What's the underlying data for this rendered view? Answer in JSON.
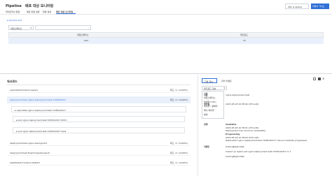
{
  "header": {
    "title": "Pipeline",
    "separator": "›",
    "page": "배포 대상 모니터링",
    "right_buttons": [
      "URL & Apikey",
      "마블어 가이드"
    ],
    "tabs": [
      "파이프라인 편집",
      "배포 환경 설정",
      "환경 설정",
      "배포 대상 모니터링"
    ],
    "active_tab": 3
  },
  "top": {
    "pipeline_link": "pipeline-test",
    "select_value": "네임스페이스",
    "search_placeholder": "",
    "table_headers": [
      "네임스페이스",
      "워크로드"
    ],
    "table_row": [
      "test",
      "15"
    ]
  },
  "bottom_left": {
    "title": "워크로드",
    "rows": [
      {
        "name": "replicaSet-frontend-replica",
        "state": "화드: 4 / 1(100%)"
      },
      {
        "name": "deployment-test-nginx-deployment-test-74d5b4dd17",
        "state": "화드: 4 / 1(100%)",
        "selected": true
      },
      {
        "name": "replicaSet-nginx-deployment-test-74d5b4dd17",
        "sub": true
      },
      {
        "name": "pod-nginx-deployment-test-74d5b4dd17-8ctrb",
        "sub2": true
      },
      {
        "name": "pod-nginx-deployment-test-74d5b4dd17-fvpq",
        "sub2": true
      },
      {
        "name": "deployment-test-nginx-deployment",
        "state": "화드: 4 / 1(100%)"
      },
      {
        "name": "deployment-test-fluentd-elasticsearch",
        "state": "화드: 4 / 1(100%)"
      },
      {
        "name": "statefulSet-frontend-stateful",
        "state": "화드: 4 / 1(100%)"
      }
    ]
  },
  "bottom_right": {
    "tabs": [
      "기본 정보",
      "관리 이벤트"
    ],
    "dropdown_value": "워크로드 정보",
    "dropdown_options": [
      "이름",
      "네임스페이스",
      "생성일 (UTC)",
      "레이블 / 셀렉터",
      "매니 레이블",
      "활성"
    ],
    "details": [
      {
        "label": "이름",
        "value": "nginx-deployment-test"
      },
      {
        "label": "생성일",
        "value": "2023-05-18 10:38:00 (UTC+00)"
      },
      {
        "label": "상태",
        "value": "Available"
      },
      {
        "label": "",
        "value": "2023-05-18 10:38:01 (UTC+00)"
      },
      {
        "label": "",
        "value": "Deployment has minimum availability."
      },
      {
        "label": "",
        "value": "Progressing"
      },
      {
        "label": "",
        "value": "2023-05-18 10:38:00 (UTC+00)"
      },
      {
        "label": "",
        "value": "ReplicaSet 'nginx-deployment-test-74d5b4dd17' has successfully progressed."
      },
      {
        "label": "이벤트",
        "value": "ScalingReplicaSet"
      },
      {
        "label": "",
        "value": "Scaled up replica set nginx-deployment-test-74d5b4dd17 to 1"
      },
      {
        "label": "",
        "value": "ScalingReplicaSet"
      }
    ]
  }
}
